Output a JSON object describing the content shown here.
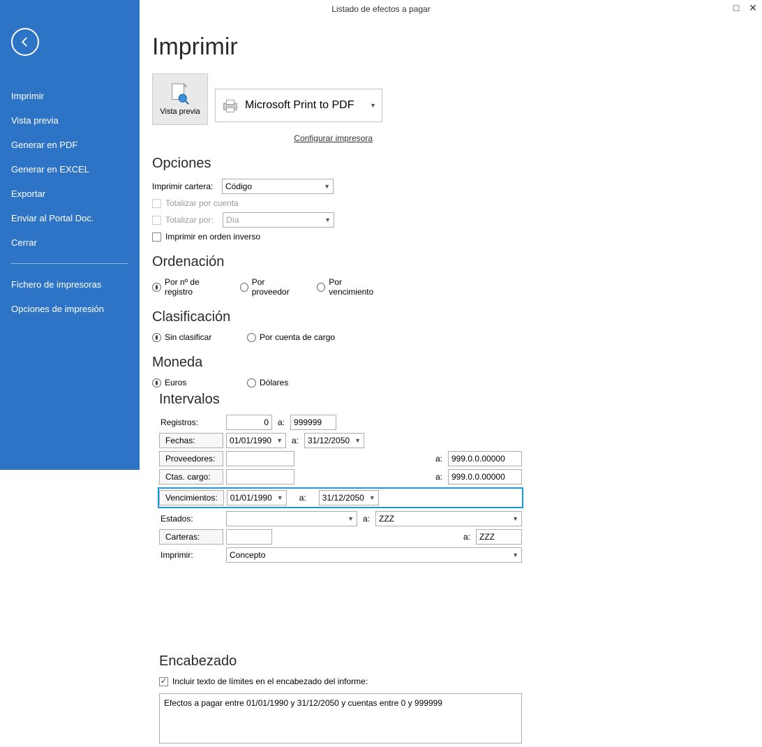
{
  "window": {
    "title": "Listado de efectos a pagar"
  },
  "sidebar": {
    "items": [
      "Imprimir",
      "Vista previa",
      "Generar en PDF",
      "Generar en EXCEL",
      "Exportar",
      "Enviar al Portal Doc.",
      "Cerrar"
    ],
    "footer": [
      "Fichero de impresoras",
      "Opciones de impresión"
    ]
  },
  "page": {
    "heading": "Imprimir",
    "preview_btn": "Vista previa",
    "printer": "Microsoft Print to PDF",
    "config_link": "Configurar impresora",
    "opciones_h": "Opciones",
    "imprimir_cartera_lbl": "Imprimir cartera:",
    "imprimir_cartera_val": "Código",
    "tot_cuenta": "Totalizar por cuenta",
    "tot_por_lbl": "Totalizar por:",
    "tot_por_val": "Día",
    "orden_inv": "Imprimir en orden inverso",
    "orden_h": "Ordenación",
    "ord_reg": "Por nº de registro",
    "ord_prov": "Por proveedor",
    "ord_venc": "Por vencimiento",
    "clas_h": "Clasificación",
    "clas_sin": "Sin clasificar",
    "clas_cargo": "Por cuenta de cargo",
    "moneda_h": "Moneda",
    "mon_eur": "Euros",
    "mon_usd": "Dólares"
  },
  "intervalos": {
    "heading": "Intervalos",
    "a": "a:",
    "registros_lbl": "Registros:",
    "registros_from": "0",
    "registros_to": "999999",
    "fechas_btn": "Fechas:",
    "fechas_from": "01/01/1990",
    "fechas_to": "31/12/2050",
    "prov_btn": "Proveedores:",
    "prov_to": "999.0.0.00000",
    "ctas_btn": "Ctas. cargo:",
    "ctas_to": "999.0.0.00000",
    "venc_btn": "Vencimientos:",
    "venc_from": "01/01/1990",
    "venc_to": "31/12/2050",
    "estados_lbl": "Estados:",
    "estados_to": "ZZZ",
    "carteras_btn": "Carteras:",
    "carteras_to": "ZZZ",
    "imprimir_lbl": "Imprimir:",
    "imprimir_val": "Concepto"
  },
  "encabezado": {
    "heading": "Encabezado",
    "chk_lbl": "Incluir texto de límites en el encabezado del informe:",
    "text": "Efectos a pagar entre 01/01/1990 y 31/12/2050 y cuentas entre 0 y 999999"
  }
}
